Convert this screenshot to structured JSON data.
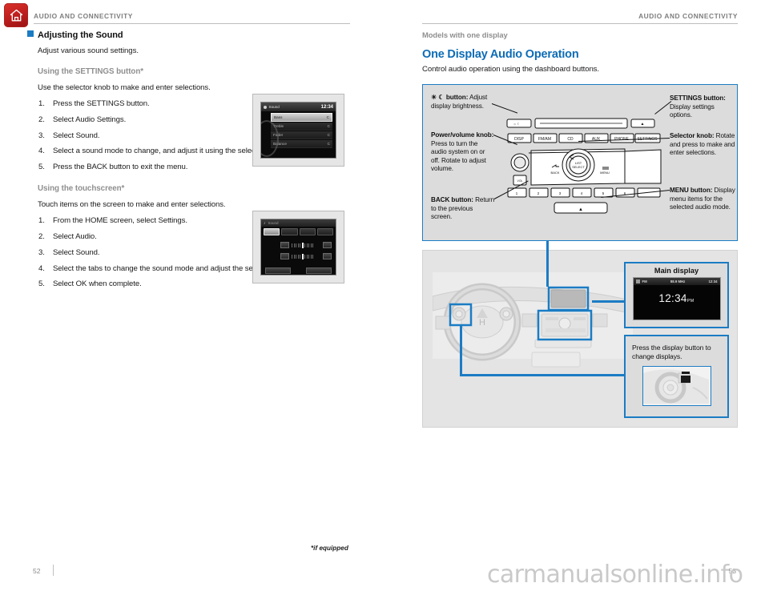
{
  "colors": {
    "accent_blue": "#0d6cb5",
    "box_blue": "#1b7cc4",
    "gray_heading": "#8f8f8f",
    "home_red": "#c22020",
    "panel_gray": "#dcdcdc"
  },
  "header": {
    "left_running_head": "AUDIO AND CONNECTIVITY",
    "right_running_head": "AUDIO AND CONNECTIVITY",
    "home_icon": "home-icon"
  },
  "left_page": {
    "section_heading": "Adjusting the Sound",
    "section_intro": "Adjust various sound settings.",
    "subsection_1": {
      "heading": "Using the SETTINGS button*",
      "lead": "Use the selector knob to make and enter selections.",
      "steps": [
        {
          "num": "1.",
          "text": "Press the SETTINGS button."
        },
        {
          "num": "2.",
          "text": "Select Audio Settings."
        },
        {
          "num": "3.",
          "text": "Select Sound."
        },
        {
          "num": "4.",
          "text": "Select a sound mode to change, and adjust it using the selector knob."
        },
        {
          "num": "5.",
          "text": "Press the BACK button to exit the menu."
        }
      ]
    },
    "subsection_2": {
      "heading": "Using the touchscreen*",
      "lead": "Touch items on the screen to make and enter selections.",
      "steps": [
        {
          "num": "1.",
          "text": "From the HOME screen, select Settings."
        },
        {
          "num": "2.",
          "text": "Select Audio."
        },
        {
          "num": "3.",
          "text": "Select Sound."
        },
        {
          "num": "4.",
          "text": "Select the tabs to change the sound mode and adjust the setting."
        },
        {
          "num": "5.",
          "text": "Select OK when complete."
        }
      ]
    },
    "screenshot_sound_menu": {
      "title": "Sound",
      "time": "12:34",
      "rows": [
        {
          "label": "Bass",
          "value": "C",
          "selected": true
        },
        {
          "label": "Treble",
          "value": "C",
          "selected": false
        },
        {
          "label": "Fader",
          "value": "C",
          "selected": false
        },
        {
          "label": "Balance",
          "value": "C",
          "selected": false
        }
      ]
    },
    "screenshot_touchscreen": {
      "title": "Sound",
      "tabs": [
        "Bass",
        "Treble",
        "Fader",
        "Balance"
      ],
      "sliders": [
        {
          "label": "Bass"
        },
        {
          "label": "Treble"
        }
      ]
    }
  },
  "right_page": {
    "kicker": "Models with one display",
    "title": "One Display Audio Operation",
    "subtitle": "Control audio operation using the dashboard buttons.",
    "callouts": {
      "brightness": {
        "bold": "☀ ☾ button:",
        "text": " Adjust display brightness."
      },
      "power_volume": {
        "bold": "Power/volume knob:",
        "text": " Press to turn the audio system on or off. Rotate to adjust volume."
      },
      "back": {
        "bold": "BACK button:",
        "text": " Return to the previous screen."
      },
      "settings": {
        "bold": "SETTINGS button:",
        "text": " Display settings options."
      },
      "selector_knob": {
        "bold": "Selector knob:",
        "text": " Rotate and press to make and enter selections."
      },
      "menu": {
        "bold": "MENU button:",
        "text": " Display menu items for the selected audio mode."
      }
    },
    "head_unit_buttons": [
      "DISP",
      "FM/AM",
      "CD",
      "AUX",
      "PHONE",
      "SETTINGS"
    ],
    "head_unit_center": "LIST/SELECT",
    "head_unit_back": "BACK",
    "head_unit_menu": "MENU",
    "head_unit_presets": [
      "1",
      "2",
      "3",
      "4",
      "5",
      "6"
    ],
    "main_display_box": {
      "title": "Main display",
      "band": "FM",
      "frequency": "88.9 MHz",
      "status_time": "12:34",
      "clock": "12:34",
      "clock_suffix": "PM"
    },
    "display_button_box": {
      "text": "Press the display button to change displays."
    }
  },
  "footer": {
    "footnote": "*if equipped",
    "page_left": "52",
    "page_right": "53",
    "watermark": "carmanualsonline.info"
  }
}
